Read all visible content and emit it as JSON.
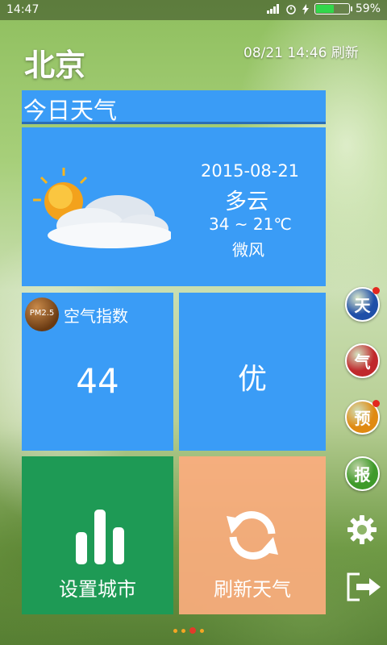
{
  "status_bar": {
    "time": "14:47",
    "battery_percent": "59%",
    "battery_level": 0.59
  },
  "header": {
    "city": "北京",
    "update_text": "08/21 14:46 刷新"
  },
  "today": {
    "title": "今日天气",
    "date": "2015-08-21",
    "condition": "多云",
    "temperature": "34 ~ 21℃",
    "wind": "微风",
    "icon": "partly-cloudy-icon"
  },
  "air": {
    "label": "空气指数",
    "badge": "PM2.5",
    "value": "44"
  },
  "quality": {
    "value": "优"
  },
  "actions": {
    "set_city": "设置城市",
    "refresh": "刷新天气"
  },
  "side_menu": {
    "items": [
      {
        "label": "天",
        "color": "#1f4fa8",
        "dot": true
      },
      {
        "label": "气",
        "color": "#c0282c",
        "dot": false
      },
      {
        "label": "预",
        "color": "#e08a12",
        "dot": true
      },
      {
        "label": "报",
        "color": "#3f9a2a",
        "dot": false
      }
    ],
    "settings_icon": "gear-icon",
    "exit_icon": "exit-icon"
  },
  "pager": {
    "count": 4,
    "active_index": 2
  },
  "colors": {
    "tile_blue": "#3a9cf6",
    "tile_green": "#1e9a55",
    "tile_orange": "#fcac7e"
  }
}
